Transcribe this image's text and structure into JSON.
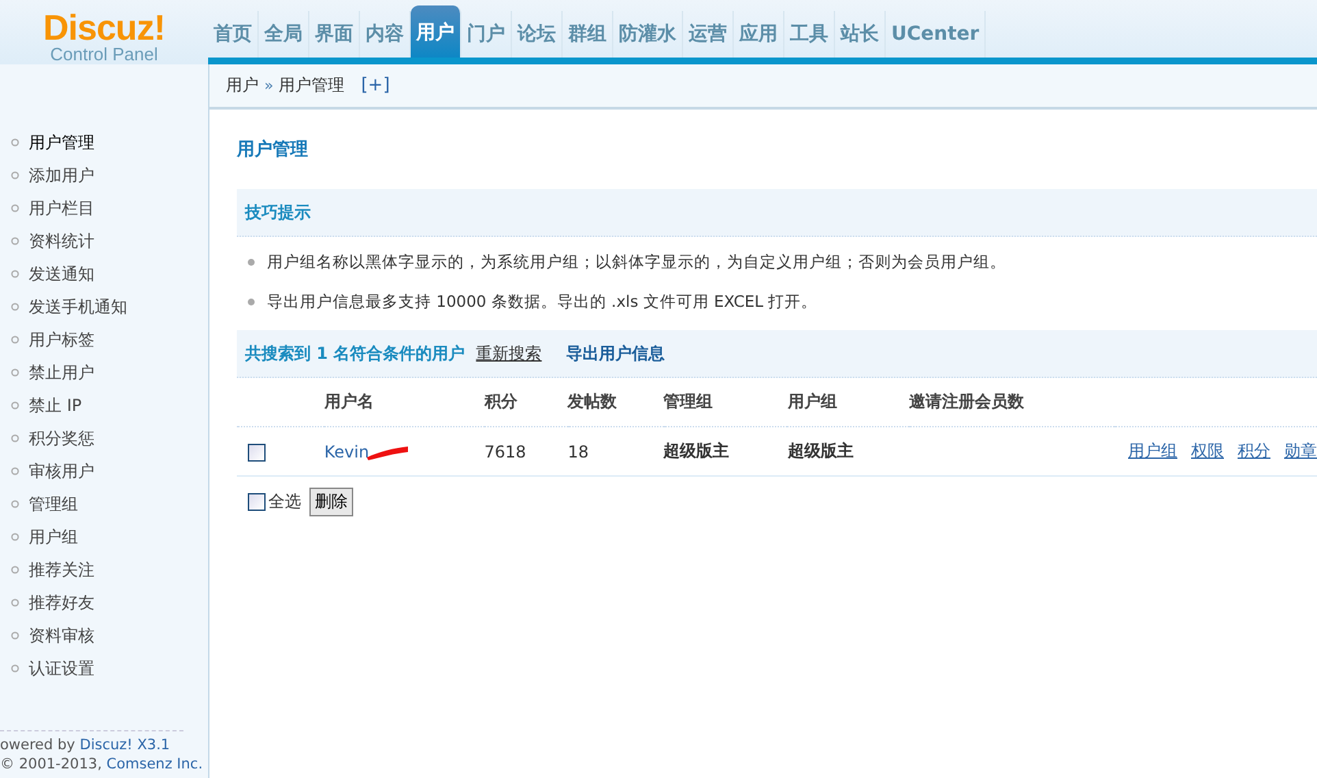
{
  "logo": {
    "title": "Discuz!",
    "subtitle": "Control Panel"
  },
  "nav": [
    {
      "label": "首页",
      "selected": false
    },
    {
      "label": "全局",
      "selected": false
    },
    {
      "label": "界面",
      "selected": false
    },
    {
      "label": "内容",
      "selected": false
    },
    {
      "label": "用户",
      "selected": true
    },
    {
      "label": "门户",
      "selected": false
    },
    {
      "label": "论坛",
      "selected": false
    },
    {
      "label": "群组",
      "selected": false
    },
    {
      "label": "防灌水",
      "selected": false
    },
    {
      "label": "运营",
      "selected": false
    },
    {
      "label": "应用",
      "selected": false
    },
    {
      "label": "工具",
      "selected": false
    },
    {
      "label": "站长",
      "selected": false
    },
    {
      "label": "UCenter",
      "selected": false
    }
  ],
  "breadcrumb": {
    "items": [
      "用户",
      "用户管理"
    ],
    "separator": "»",
    "add": "[+]"
  },
  "sidebar": {
    "items": [
      {
        "label": "用户管理",
        "selected": true
      },
      {
        "label": "添加用户",
        "selected": false
      },
      {
        "label": "用户栏目",
        "selected": false
      },
      {
        "label": "资料统计",
        "selected": false
      },
      {
        "label": "发送通知",
        "selected": false
      },
      {
        "label": "发送手机通知",
        "selected": false
      },
      {
        "label": "用户标签",
        "selected": false
      },
      {
        "label": "禁止用户",
        "selected": false
      },
      {
        "label": "禁止 IP",
        "selected": false
      },
      {
        "label": "积分奖惩",
        "selected": false
      },
      {
        "label": "审核用户",
        "selected": false
      },
      {
        "label": "管理组",
        "selected": false
      },
      {
        "label": "用户组",
        "selected": false
      },
      {
        "label": "推荐关注",
        "selected": false
      },
      {
        "label": "推荐好友",
        "selected": false
      },
      {
        "label": "资料审核",
        "selected": false
      },
      {
        "label": "认证设置",
        "selected": false
      }
    ],
    "footer": {
      "line_1": {
        "text": "owered by ",
        "link": "Discuz! X3.1"
      },
      "line_2": {
        "text": "© 2001-2013, ",
        "link": "Comsenz Inc."
      }
    }
  },
  "page_title": "用户管理",
  "tips": {
    "title": "技巧提示",
    "items": [
      "用户组名称以黑体字显示的，为系统用户组；以斜体字显示的，为自定义用户组；否则为会员用户组。",
      "导出用户信息最多支持 10000 条数据。导出的 .xls 文件可用 EXCEL 打开。"
    ]
  },
  "results": {
    "summary": "共搜索到 1 名符合条件的用户",
    "research": "重新搜索",
    "export": "导出用户信息"
  },
  "table": {
    "columns": [
      "用户名",
      "积分",
      "发帖数",
      "管理组",
      "用户组",
      "邀请注册会员数"
    ],
    "rows": [
      {
        "checked": false,
        "username": "Kevin",
        "redacted": true,
        "credits": "7618",
        "posts": "18",
        "admin_group": "超级版主",
        "user_group": "超级版主",
        "invites": "",
        "actions": [
          "用户组",
          "权限",
          "积分",
          "勋章"
        ]
      }
    ]
  },
  "select_all": {
    "label": "全选",
    "checked": false
  },
  "delete_button": "删除"
}
